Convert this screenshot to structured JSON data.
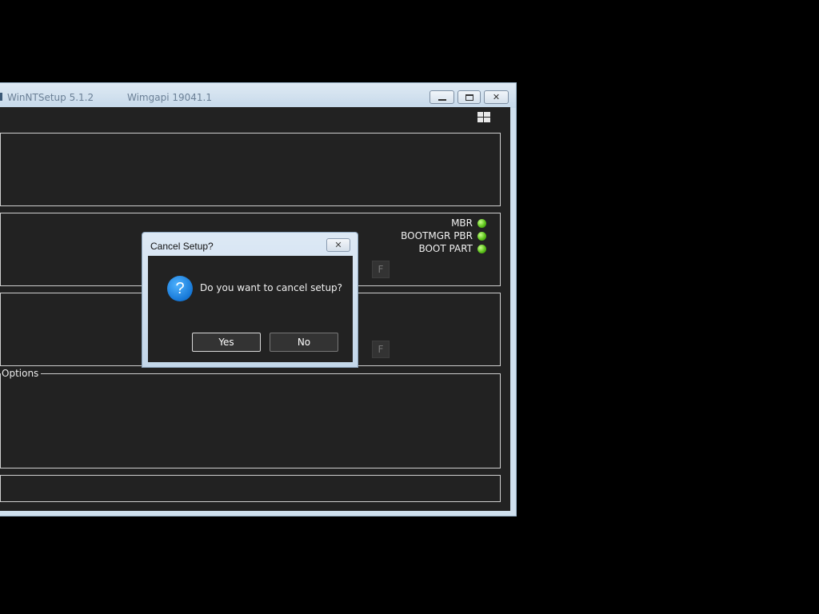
{
  "window": {
    "title": "WinNTSetup 5.1.2",
    "subtitle": "Wimgapi 19041.1"
  },
  "panel": {
    "options_label": "Options",
    "status_items": [
      {
        "label": "MBR",
        "status": "green"
      },
      {
        "label": "BOOTMGR PBR",
        "status": "green"
      },
      {
        "label": "BOOT PART",
        "status": "green"
      }
    ],
    "f_button_label": "F"
  },
  "dialog": {
    "title": "Cancel Setup?",
    "message": "Do you want to cancel setup?",
    "icon": "question-icon",
    "yes_label": "Yes",
    "no_label": "No"
  },
  "colors": {
    "background": "#000000",
    "client": "#222222",
    "led_green": "#5cc21a",
    "question_blue": "#1677d6"
  }
}
